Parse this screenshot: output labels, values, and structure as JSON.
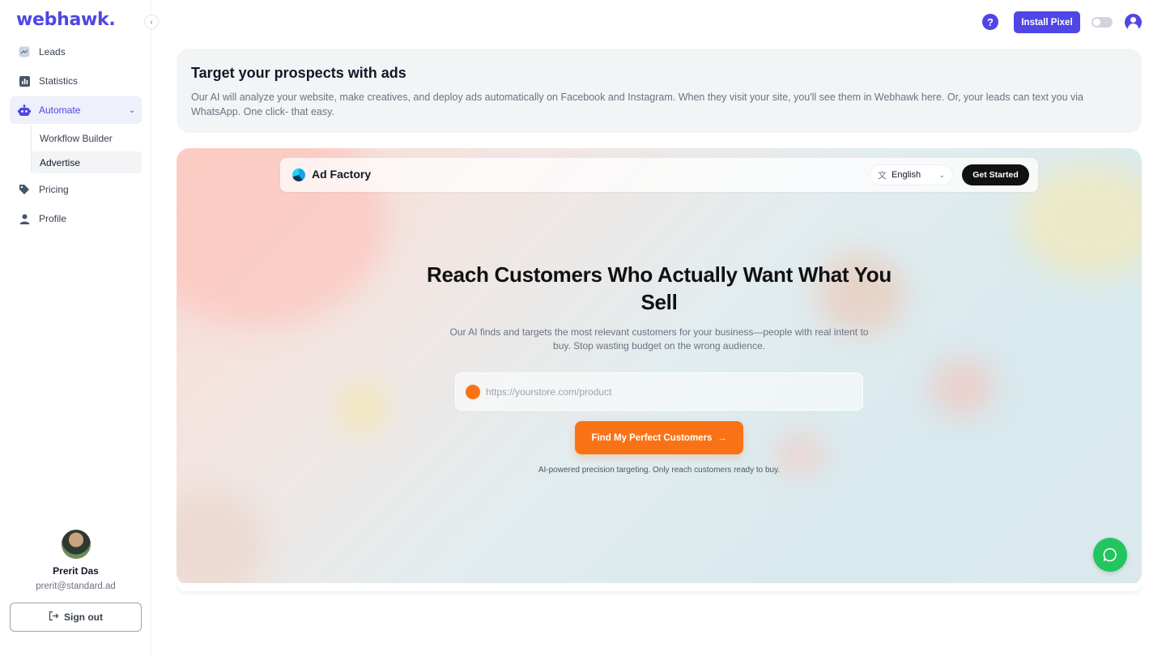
{
  "sidebar": {
    "logo": "webhawk.",
    "items": [
      {
        "label": "Leads",
        "icon": "leads-icon"
      },
      {
        "label": "Statistics",
        "icon": "bar-chart-icon"
      },
      {
        "label": "Automate",
        "icon": "robot-icon"
      },
      {
        "label": "Pricing",
        "icon": "tag-icon"
      },
      {
        "label": "Profile",
        "icon": "person-icon"
      }
    ],
    "subitems": [
      "Workflow Builder",
      "Advertise"
    ],
    "user": {
      "name": "Prerit Das",
      "email": "prerit@standard.ad"
    },
    "signout_label": "Sign out"
  },
  "topbar": {
    "help_label": "?",
    "install_label": "Install Pixel"
  },
  "info": {
    "title": "Target your prospects with ads",
    "text": "Our AI will analyze your website, make creatives, and deploy ads automatically on Facebook and Instagram. When they visit your site, you'll see them in Webhawk here. Or, your leads can text you via WhatsApp. One click- that easy."
  },
  "adfactory": {
    "brand": "Ad Factory",
    "language": "English",
    "get_started": "Get Started",
    "hero_title": "Reach Customers Who Actually Want What You Sell",
    "hero_sub": "Our AI finds and targets the most relevant customers for your business—people with real intent to buy. Stop wasting budget on the wrong audience.",
    "url_placeholder": "https://yourstore.com/product",
    "cta_label": "Find My Perfect Customers",
    "note": "AI-powered precision targeting. Only reach customers ready to buy."
  },
  "colors": {
    "brand": "#4f46e5",
    "cta": "#f97316",
    "chat": "#22c55e"
  }
}
